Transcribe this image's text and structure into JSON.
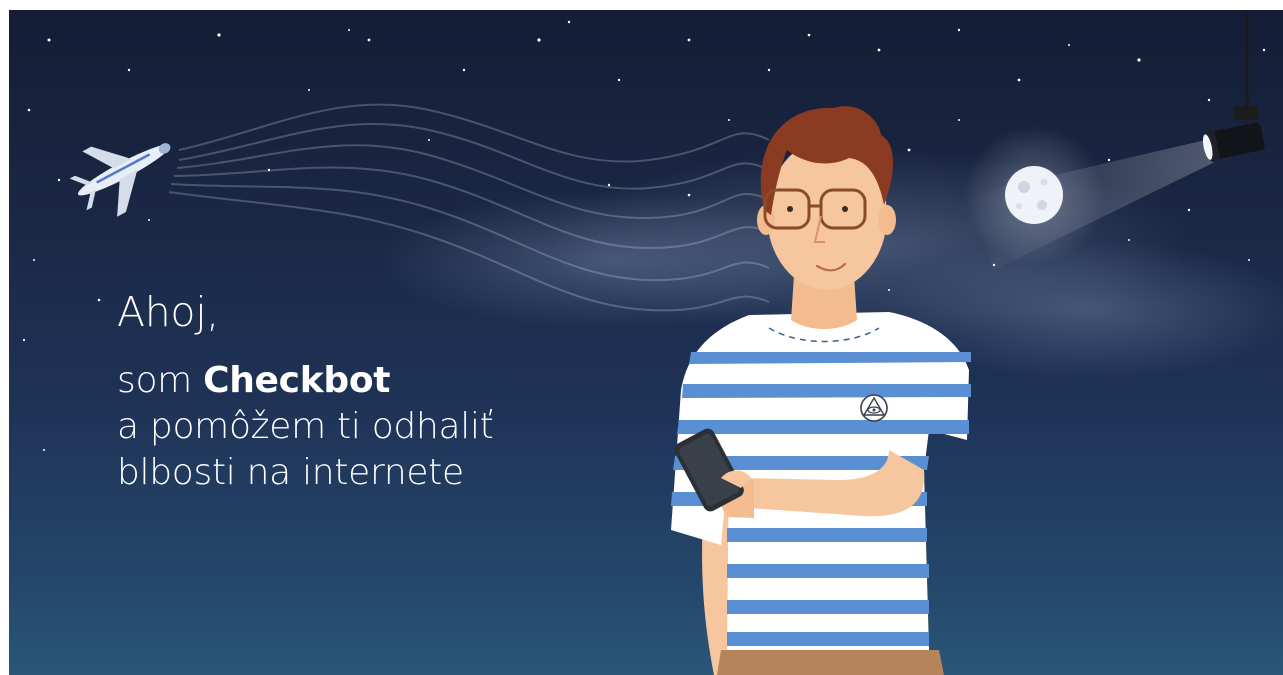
{
  "greeting": "Ahoj,",
  "intro": {
    "line1_prefix": "som",
    "name": "Checkbot",
    "line2": "a pomôžem ti odhaliť",
    "line3": "blbosti na internete"
  },
  "colors": {
    "sky_top": "#141d35",
    "sky_bottom": "#2a5677",
    "shirt_stripe": "#5b8fd4",
    "hair": "#8a3b22"
  },
  "icons": [
    "airplane-icon",
    "moon-icon",
    "spotlight-icon",
    "eye-triangle-logo-icon",
    "phone-icon"
  ]
}
